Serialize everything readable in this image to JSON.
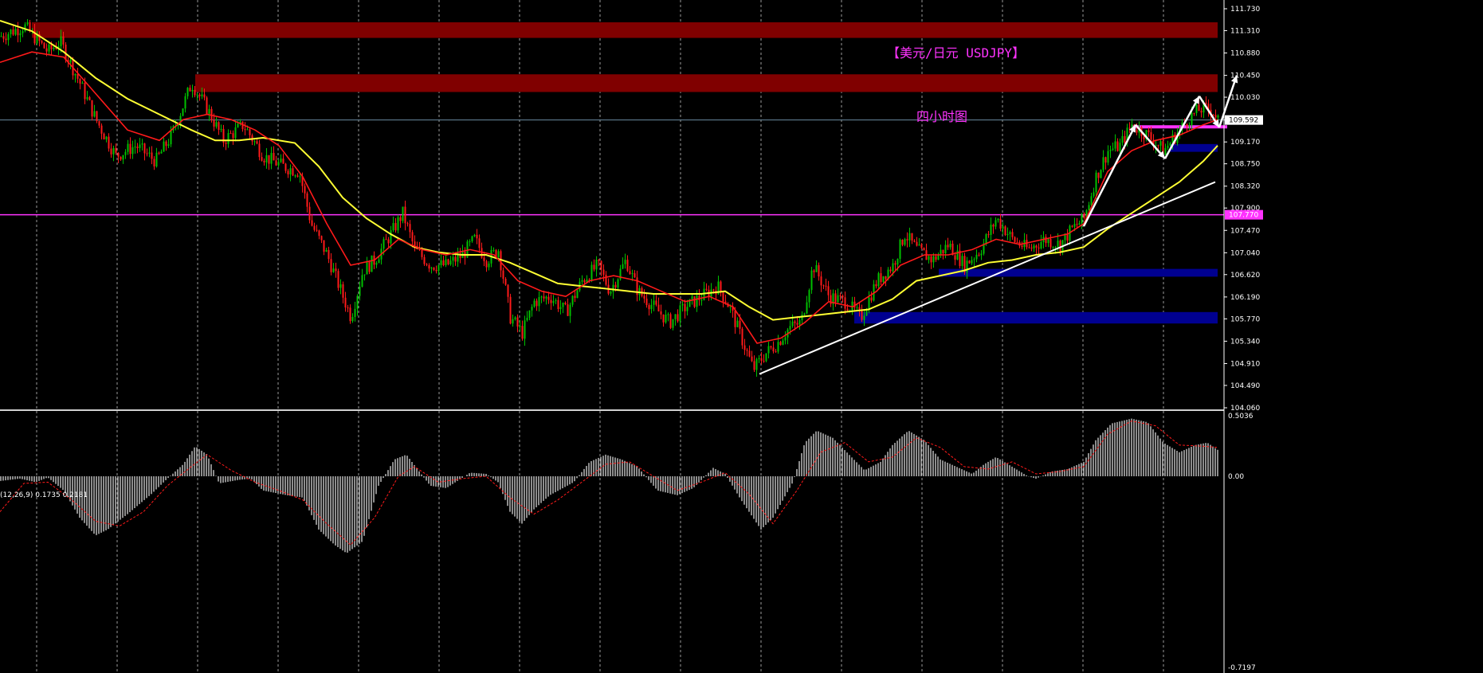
{
  "chart_title": "【美元/日元 USDJPY】",
  "chart_subtitle": "四小时图",
  "indicator_label": "(12,26,9) 0.1735 0.2181",
  "colors": {
    "background": "#000000",
    "up_candle": "#00c000",
    "down_candle": "#ff1a1a",
    "ma_fast": "#ff1a1a",
    "ma_slow": "#ffff33",
    "resistance_zone": "#800000",
    "support_zone": "#000090",
    "horizontal_line": "#ff33ff",
    "current_price_line": "#6a8aa0",
    "trendline": "#ffffff",
    "title": "#ff33ff",
    "histogram": "#c8c8c8",
    "signal_line": "#ff1a1a",
    "grid": "#9a9a9a"
  },
  "chart_data": [
    {
      "type": "candlestick",
      "title": "【美元/日元 USDJPY】",
      "subtitle": "四小时图",
      "y_ticks": [
        "111.730",
        "111.310",
        "110.880",
        "110.450",
        "110.030",
        "109.592",
        "109.170",
        "108.750",
        "108.320",
        "107.900",
        "107.470",
        "107.040",
        "106.620",
        "106.190",
        "105.770",
        "105.340",
        "104.910",
        "104.490",
        "104.060"
      ],
      "ylim": [
        104.06,
        111.73
      ],
      "price_markers": [
        {
          "label": "109.592",
          "value": 109.592
        },
        {
          "label": "107.770",
          "value": 107.77
        }
      ],
      "zones": [
        {
          "kind": "resistance",
          "low": 111.17,
          "high": 111.47
        },
        {
          "kind": "resistance",
          "low": 110.13,
          "high": 110.47
        },
        {
          "kind": "support",
          "low": 106.58,
          "high": 106.73
        },
        {
          "kind": "support",
          "low": 105.68,
          "high": 105.9
        },
        {
          "kind": "support",
          "low": 108.98,
          "high": 109.13
        }
      ],
      "horizontal_lines": [
        107.77,
        109.592
      ],
      "price_path": [
        [
          0,
          111.2
        ],
        [
          30,
          111.4
        ],
        [
          60,
          110.9
        ],
        [
          75,
          111.1
        ],
        [
          100,
          110.3
        ],
        [
          120,
          109.6
        ],
        [
          145,
          108.9
        ],
        [
          170,
          109.1
        ],
        [
          195,
          108.8
        ],
        [
          215,
          109.3
        ],
        [
          240,
          110.3
        ],
        [
          260,
          109.8
        ],
        [
          280,
          109.2
        ],
        [
          305,
          109.5
        ],
        [
          330,
          108.9
        ],
        [
          355,
          108.7
        ],
        [
          375,
          108.6
        ],
        [
          390,
          107.6
        ],
        [
          410,
          107.0
        ],
        [
          425,
          106.4
        ],
        [
          440,
          105.8
        ],
        [
          455,
          106.7
        ],
        [
          470,
          106.9
        ],
        [
          490,
          107.4
        ],
        [
          505,
          107.8
        ],
        [
          520,
          107.1
        ],
        [
          540,
          106.8
        ],
        [
          560,
          106.8
        ],
        [
          580,
          107.0
        ],
        [
          595,
          107.3
        ],
        [
          610,
          106.9
        ],
        [
          625,
          107.1
        ],
        [
          640,
          105.8
        ],
        [
          655,
          105.5
        ],
        [
          670,
          106.1
        ],
        [
          690,
          106.2
        ],
        [
          710,
          105.9
        ],
        [
          730,
          106.5
        ],
        [
          750,
          106.8
        ],
        [
          765,
          106.3
        ],
        [
          785,
          106.9
        ],
        [
          800,
          106.3
        ],
        [
          820,
          106.0
        ],
        [
          840,
          105.7
        ],
        [
          860,
          106.0
        ],
        [
          880,
          106.2
        ],
        [
          900,
          106.4
        ],
        [
          915,
          106.0
        ],
        [
          930,
          105.4
        ],
        [
          945,
          104.8
        ],
        [
          960,
          105.1
        ],
        [
          975,
          105.3
        ],
        [
          990,
          105.6
        ],
        [
          1005,
          105.7
        ],
        [
          1020,
          106.8
        ],
        [
          1040,
          106.2
        ],
        [
          1060,
          106.1
        ],
        [
          1080,
          105.8
        ],
        [
          1100,
          106.5
        ],
        [
          1120,
          106.8
        ],
        [
          1135,
          107.4
        ],
        [
          1150,
          107.1
        ],
        [
          1170,
          106.9
        ],
        [
          1190,
          107.2
        ],
        [
          1210,
          106.8
        ],
        [
          1230,
          107.1
        ],
        [
          1250,
          107.7
        ],
        [
          1270,
          107.3
        ],
        [
          1290,
          107.1
        ],
        [
          1310,
          107.3
        ],
        [
          1330,
          107.2
        ],
        [
          1345,
          107.5
        ],
        [
          1360,
          107.7
        ],
        [
          1375,
          108.5
        ],
        [
          1390,
          109.0
        ],
        [
          1405,
          109.1
        ],
        [
          1420,
          109.5
        ],
        [
          1440,
          109.3
        ],
        [
          1460,
          109.0
        ],
        [
          1475,
          109.3
        ],
        [
          1490,
          109.6
        ],
        [
          1505,
          109.8
        ],
        [
          1520,
          109.8
        ],
        [
          1528,
          109.6
        ]
      ],
      "ma_fast_path": [
        [
          0,
          110.7
        ],
        [
          40,
          110.9
        ],
        [
          80,
          110.8
        ],
        [
          120,
          110.1
        ],
        [
          160,
          109.4
        ],
        [
          200,
          109.2
        ],
        [
          230,
          109.6
        ],
        [
          260,
          109.7
        ],
        [
          290,
          109.6
        ],
        [
          320,
          109.4
        ],
        [
          350,
          109.1
        ],
        [
          380,
          108.5
        ],
        [
          410,
          107.6
        ],
        [
          440,
          106.8
        ],
        [
          470,
          106.9
        ],
        [
          500,
          107.3
        ],
        [
          530,
          107.1
        ],
        [
          560,
          107.0
        ],
        [
          590,
          107.1
        ],
        [
          620,
          107.0
        ],
        [
          650,
          106.5
        ],
        [
          680,
          106.3
        ],
        [
          710,
          106.2
        ],
        [
          740,
          106.5
        ],
        [
          770,
          106.6
        ],
        [
          800,
          106.5
        ],
        [
          830,
          106.3
        ],
        [
          860,
          106.1
        ],
        [
          890,
          106.2
        ],
        [
          920,
          106.0
        ],
        [
          950,
          105.3
        ],
        [
          980,
          105.4
        ],
        [
          1010,
          105.7
        ],
        [
          1040,
          106.1
        ],
        [
          1070,
          106.0
        ],
        [
          1100,
          106.3
        ],
        [
          1130,
          106.8
        ],
        [
          1160,
          107.0
        ],
        [
          1190,
          107.0
        ],
        [
          1220,
          107.1
        ],
        [
          1250,
          107.3
        ],
        [
          1280,
          107.2
        ],
        [
          1310,
          107.3
        ],
        [
          1340,
          107.4
        ],
        [
          1360,
          107.6
        ],
        [
          1390,
          108.6
        ],
        [
          1420,
          109.0
        ],
        [
          1450,
          109.2
        ],
        [
          1480,
          109.3
        ],
        [
          1510,
          109.5
        ],
        [
          1528,
          109.6
        ]
      ],
      "ma_slow_path": [
        [
          0,
          111.5
        ],
        [
          40,
          111.3
        ],
        [
          80,
          110.9
        ],
        [
          120,
          110.4
        ],
        [
          160,
          110.0
        ],
        [
          200,
          109.7
        ],
        [
          240,
          109.4
        ],
        [
          270,
          109.2
        ],
        [
          300,
          109.2
        ],
        [
          330,
          109.25
        ],
        [
          370,
          109.15
        ],
        [
          400,
          108.7
        ],
        [
          430,
          108.1
        ],
        [
          460,
          107.7
        ],
        [
          490,
          107.4
        ],
        [
          520,
          107.15
        ],
        [
          550,
          107.05
        ],
        [
          580,
          107.0
        ],
        [
          610,
          107.0
        ],
        [
          640,
          106.85
        ],
        [
          670,
          106.65
        ],
        [
          700,
          106.45
        ],
        [
          730,
          106.4
        ],
        [
          760,
          106.35
        ],
        [
          790,
          106.3
        ],
        [
          820,
          106.25
        ],
        [
          850,
          106.25
        ],
        [
          880,
          106.25
        ],
        [
          910,
          106.3
        ],
        [
          940,
          106.0
        ],
        [
          970,
          105.75
        ],
        [
          1000,
          105.8
        ],
        [
          1030,
          105.85
        ],
        [
          1060,
          105.9
        ],
        [
          1090,
          105.95
        ],
        [
          1120,
          106.15
        ],
        [
          1150,
          106.5
        ],
        [
          1180,
          106.6
        ],
        [
          1210,
          106.7
        ],
        [
          1240,
          106.85
        ],
        [
          1270,
          106.9
        ],
        [
          1300,
          107.0
        ],
        [
          1330,
          107.05
        ],
        [
          1360,
          107.15
        ],
        [
          1390,
          107.5
        ],
        [
          1420,
          107.8
        ],
        [
          1450,
          108.1
        ],
        [
          1480,
          108.4
        ],
        [
          1510,
          108.8
        ],
        [
          1528,
          109.1
        ]
      ],
      "trendlines": [
        {
          "from": [
            953,
            104.71
          ],
          "to": [
            1525,
            108.4
          ]
        },
        {
          "from": [
            1360,
            107.55
          ],
          "to": [
            1425,
            109.5
          ]
        },
        {
          "from": [
            1425,
            109.5
          ],
          "to": [
            1462,
            108.85
          ]
        },
        {
          "from": [
            1462,
            108.85
          ],
          "to": [
            1505,
            110.05
          ]
        },
        {
          "from": [
            1505,
            110.05
          ],
          "to": [
            1530,
            109.45
          ]
        },
        {
          "from": [
            1530,
            109.45
          ],
          "to": [
            1552,
            110.45
          ]
        }
      ],
      "magenta_segment": {
        "from": 1420,
        "to": 1540,
        "value": 109.46
      }
    },
    {
      "type": "macd",
      "label": "(12,26,9) 0.1735 0.2181",
      "y_ticks": [
        "0.5036",
        "0.00",
        "-0.7197"
      ],
      "ylim": [
        -0.7197,
        0.5036
      ],
      "histogram_path": [
        [
          0,
          -0.04
        ],
        [
          25,
          -0.02
        ],
        [
          45,
          -0.05
        ],
        [
          60,
          -0.01
        ],
        [
          80,
          -0.12
        ],
        [
          100,
          -0.35
        ],
        [
          120,
          -0.5
        ],
        [
          135,
          -0.45
        ],
        [
          160,
          -0.32
        ],
        [
          190,
          -0.15
        ],
        [
          210,
          -0.02
        ],
        [
          230,
          0.1
        ],
        [
          245,
          0.25
        ],
        [
          260,
          0.18
        ],
        [
          275,
          -0.06
        ],
        [
          300,
          -0.03
        ],
        [
          315,
          -0.02
        ],
        [
          330,
          -0.12
        ],
        [
          360,
          -0.16
        ],
        [
          380,
          -0.18
        ],
        [
          400,
          -0.45
        ],
        [
          420,
          -0.58
        ],
        [
          435,
          -0.65
        ],
        [
          455,
          -0.55
        ],
        [
          475,
          -0.08
        ],
        [
          495,
          0.14
        ],
        [
          510,
          0.18
        ],
        [
          525,
          0.05
        ],
        [
          540,
          -0.08
        ],
        [
          560,
          -0.1
        ],
        [
          590,
          0.03
        ],
        [
          610,
          0.02
        ],
        [
          625,
          -0.05
        ],
        [
          640,
          -0.3
        ],
        [
          655,
          -0.4
        ],
        [
          670,
          -0.28
        ],
        [
          690,
          -0.16
        ],
        [
          720,
          -0.05
        ],
        [
          740,
          0.12
        ],
        [
          760,
          0.18
        ],
        [
          780,
          0.14
        ],
        [
          800,
          0.08
        ],
        [
          825,
          -0.12
        ],
        [
          850,
          -0.16
        ],
        [
          870,
          -0.1
        ],
        [
          895,
          0.07
        ],
        [
          910,
          0.02
        ],
        [
          930,
          -0.2
        ],
        [
          955,
          -0.45
        ],
        [
          970,
          -0.35
        ],
        [
          995,
          -0.05
        ],
        [
          1010,
          0.28
        ],
        [
          1025,
          0.38
        ],
        [
          1045,
          0.32
        ],
        [
          1070,
          0.15
        ],
        [
          1085,
          0.05
        ],
        [
          1105,
          0.12
        ],
        [
          1120,
          0.26
        ],
        [
          1140,
          0.38
        ],
        [
          1160,
          0.3
        ],
        [
          1180,
          0.14
        ],
        [
          1200,
          0.08
        ],
        [
          1220,
          0.02
        ],
        [
          1235,
          0.1
        ],
        [
          1250,
          0.16
        ],
        [
          1270,
          0.08
        ],
        [
          1290,
          0.0
        ],
        [
          1300,
          -0.02
        ],
        [
          1320,
          0.04
        ],
        [
          1340,
          0.06
        ],
        [
          1360,
          0.12
        ],
        [
          1375,
          0.3
        ],
        [
          1395,
          0.44
        ],
        [
          1420,
          0.48
        ],
        [
          1440,
          0.45
        ],
        [
          1460,
          0.28
        ],
        [
          1480,
          0.2
        ],
        [
          1500,
          0.26
        ],
        [
          1515,
          0.28
        ],
        [
          1528,
          0.22
        ]
      ],
      "signal_path": [
        [
          0,
          -0.3
        ],
        [
          30,
          -0.06
        ],
        [
          60,
          -0.05
        ],
        [
          90,
          -0.2
        ],
        [
          120,
          -0.38
        ],
        [
          150,
          -0.42
        ],
        [
          180,
          -0.3
        ],
        [
          210,
          -0.08
        ],
        [
          240,
          0.08
        ],
        [
          260,
          0.18
        ],
        [
          290,
          0.05
        ],
        [
          320,
          -0.05
        ],
        [
          350,
          -0.12
        ],
        [
          380,
          -0.2
        ],
        [
          410,
          -0.4
        ],
        [
          440,
          -0.58
        ],
        [
          470,
          -0.35
        ],
        [
          500,
          0.0
        ],
        [
          520,
          0.08
        ],
        [
          550,
          -0.05
        ],
        [
          580,
          -0.02
        ],
        [
          610,
          0.0
        ],
        [
          640,
          -0.18
        ],
        [
          670,
          -0.32
        ],
        [
          700,
          -0.2
        ],
        [
          730,
          -0.05
        ],
        [
          760,
          0.1
        ],
        [
          790,
          0.12
        ],
        [
          820,
          0.0
        ],
        [
          850,
          -0.12
        ],
        [
          880,
          -0.05
        ],
        [
          910,
          0.03
        ],
        [
          940,
          -0.15
        ],
        [
          970,
          -0.4
        ],
        [
          1000,
          -0.12
        ],
        [
          1030,
          0.2
        ],
        [
          1060,
          0.28
        ],
        [
          1090,
          0.12
        ],
        [
          1120,
          0.16
        ],
        [
          1150,
          0.32
        ],
        [
          1180,
          0.24
        ],
        [
          1210,
          0.08
        ],
        [
          1240,
          0.06
        ],
        [
          1270,
          0.12
        ],
        [
          1300,
          0.02
        ],
        [
          1330,
          0.04
        ],
        [
          1360,
          0.08
        ],
        [
          1390,
          0.35
        ],
        [
          1420,
          0.46
        ],
        [
          1450,
          0.42
        ],
        [
          1480,
          0.26
        ],
        [
          1510,
          0.25
        ],
        [
          1528,
          0.24
        ]
      ]
    }
  ]
}
